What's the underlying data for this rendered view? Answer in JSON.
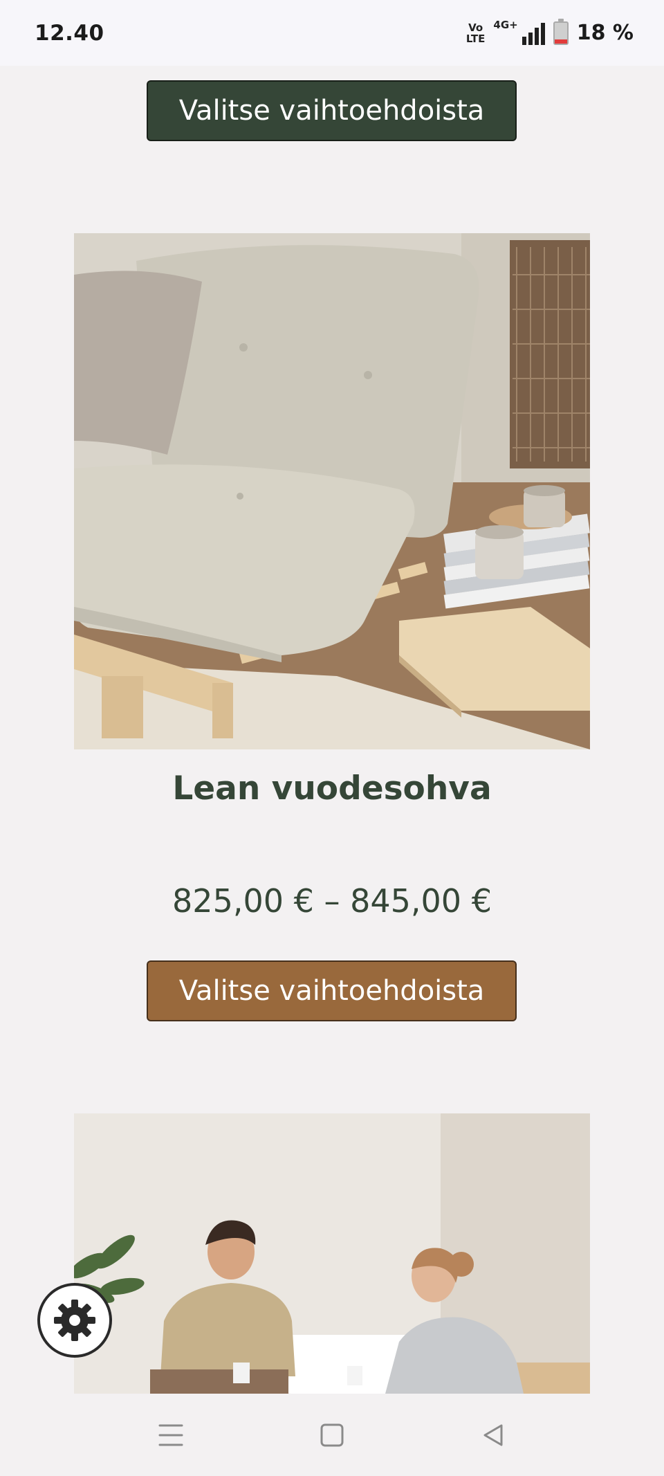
{
  "status_bar": {
    "time": "12.40",
    "volte_top": "Vo",
    "volte_bottom": "LTE",
    "network": "4G+",
    "battery_level": 0.18,
    "battery_text": "18 %"
  },
  "top_button": {
    "label": "Valitse vaihtoehdoista"
  },
  "product": {
    "title": "Lean vuodesohva",
    "price": "825,00 € – 845,00 €",
    "button_label": "Valitse vaihtoehdoista"
  },
  "colors": {
    "dark_green": "#354637",
    "brown": "#99693c",
    "background": "#f3f1f2"
  },
  "icons": {
    "settings": "gear-icon",
    "nav_menu": "menu-icon",
    "nav_home": "home-square-icon",
    "nav_back": "back-triangle-icon"
  }
}
